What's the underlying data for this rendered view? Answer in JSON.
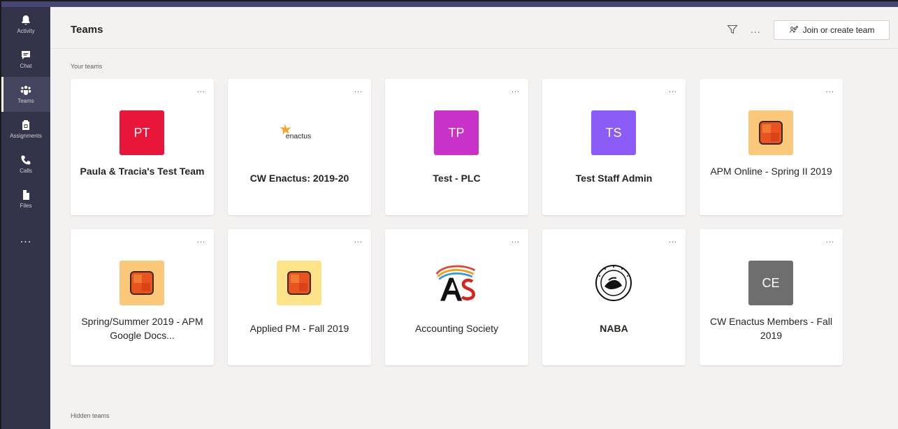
{
  "rail": {
    "items": [
      {
        "label": "Activity",
        "icon": "bell-icon"
      },
      {
        "label": "Chat",
        "icon": "chat-icon"
      },
      {
        "label": "Teams",
        "icon": "teams-icon",
        "active": true
      },
      {
        "label": "Assignments",
        "icon": "assignments-icon"
      },
      {
        "label": "Calls",
        "icon": "phone-icon"
      },
      {
        "label": "Files",
        "icon": "file-icon"
      }
    ],
    "more": "..."
  },
  "header": {
    "title": "Teams",
    "more": "...",
    "join_label": "Join or create team"
  },
  "sections": {
    "your_teams": "Your teams",
    "hidden_teams": "Hidden teams"
  },
  "teams": [
    {
      "name": "Paula & Tracia's Test Team",
      "initials": "PT",
      "color": "#e8173a",
      "bold": true
    },
    {
      "name": "CW Enactus: 2019-20",
      "logo": "enactus",
      "logo_text": "enactus",
      "bold": true
    },
    {
      "name": "Test - PLC",
      "initials": "TP",
      "color": "#c832c8",
      "bold": true
    },
    {
      "name": "Test Staff Admin",
      "initials": "TS",
      "color": "#8b5cf6",
      "bold": true
    },
    {
      "name": "APM Online - Spring II 2019",
      "logo": "orange-tile",
      "bg": "#fbc77b",
      "bold": false
    },
    {
      "name": "Spring/Summer 2019 - APM Google Docs...",
      "logo": "orange-tile",
      "bg": "#fbc77b",
      "bold": false
    },
    {
      "name": "Applied PM - Fall 2019",
      "logo": "orange-tile",
      "bg": "#fde48a",
      "bold": false
    },
    {
      "name": "Accounting Society",
      "logo": "as-logo",
      "bold": false
    },
    {
      "name": "NABA",
      "logo": "seal",
      "bold": true
    },
    {
      "name": "CW Enactus Members - Fall 2019",
      "initials": "CE",
      "color": "#6e6e6e",
      "bold": false
    }
  ],
  "card_more": "...",
  "colors": {
    "rail": "#33344a",
    "topbar": "#464775",
    "main_bg": "#f3f2f1"
  }
}
